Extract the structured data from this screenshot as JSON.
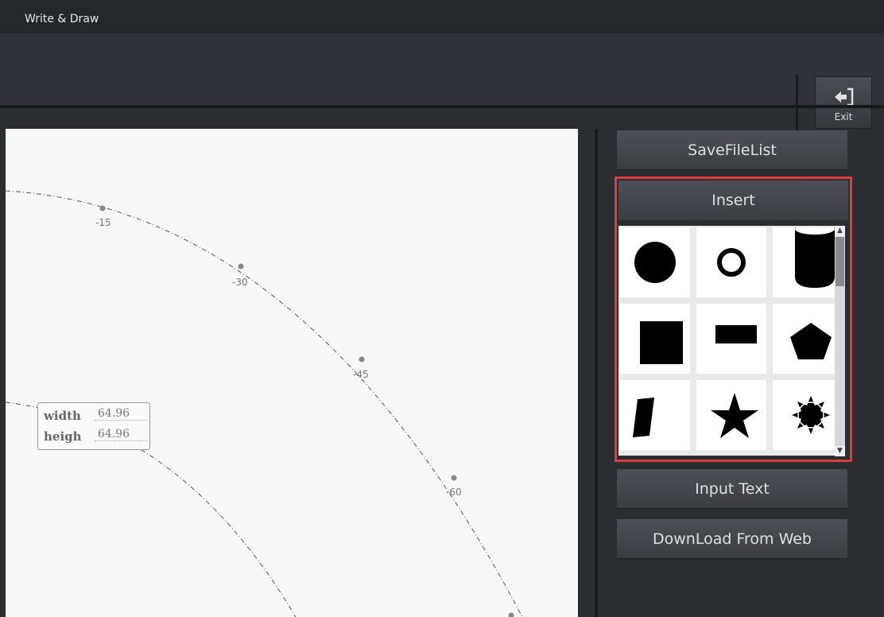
{
  "app": {
    "title": "Write & Draw"
  },
  "toolbar": {
    "exit_label": "Exit"
  },
  "canvas": {
    "ticks": [
      "-15",
      "-30",
      "-45",
      "-60"
    ],
    "size_box": {
      "width_label": "width",
      "width_value": "64.96",
      "height_label": "heigh",
      "height_value": "64.96"
    }
  },
  "sidebar": {
    "save_file_list": "SaveFileList",
    "insert": "Insert",
    "input_text": "Input Text",
    "download": "DownLoad From Web"
  },
  "shapes": [
    "circle",
    "ring",
    "cylinder",
    "square",
    "rectangle",
    "pentagon",
    "parallelogram",
    "star",
    "sun"
  ],
  "colors": {
    "highlight": "#e23b3b",
    "canvas": "#f7f7f7"
  }
}
